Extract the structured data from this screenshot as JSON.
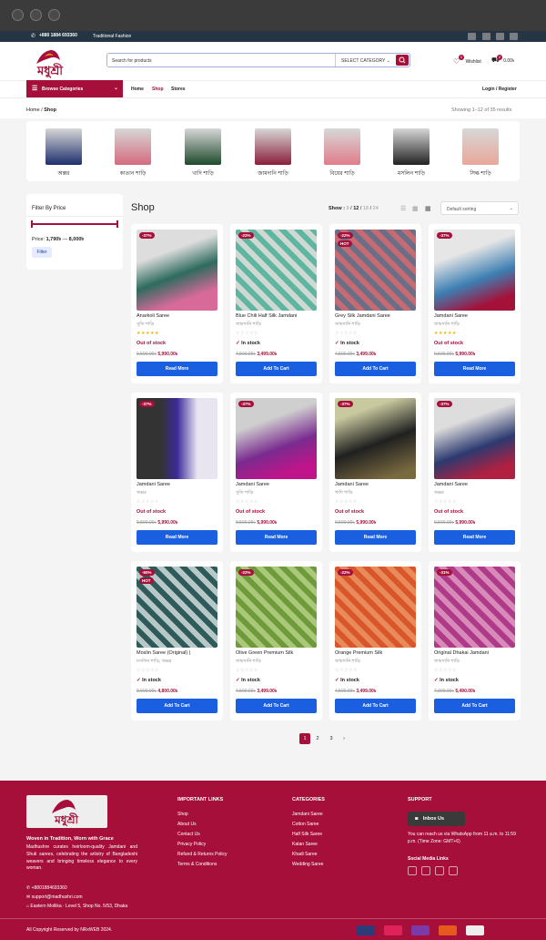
{
  "topbar": {
    "phone": "+880 1884 693360",
    "tagline": "Traditional Fashion"
  },
  "header": {
    "logo_text": "মধুশ্রী",
    "search_placeholder": "Search for products",
    "category_select": "SELECT CATEGORY",
    "wishlist": "Wishlist",
    "wishlist_count": "0",
    "cart_total": "0.00৳",
    "cart_count": "0"
  },
  "nav": {
    "browse": "Browse Categories",
    "links": [
      "Home",
      "Shop",
      "Stores"
    ],
    "login": "Login / Register"
  },
  "breadcrumb": {
    "home": "Home",
    "current": "Shop",
    "results": "Showing 1–12 of 35 results"
  },
  "categories": [
    "অক্সর",
    "কাতান শাড়ি",
    "খাদি শাড়ি",
    "জামদানি শাড়ি",
    "বিয়ের শাড়ি",
    "মসলিন শাড়ি",
    "সিল্ক শাড়ি"
  ],
  "filter": {
    "title": "Filter By Price",
    "price_label": "Price:",
    "min": "1,790৳",
    "max": "8,000৳",
    "button": "Filter"
  },
  "shop": {
    "title": "Shop",
    "show_label": "Show :",
    "show_options": [
      "9",
      "12",
      "18",
      "24"
    ],
    "sort": "Default sorting"
  },
  "products": [
    {
      "name": "Anarkoli Saree",
      "bn": "সুতি শাড়ি",
      "badge": "-37%",
      "hot": "",
      "stars": "★★★★★",
      "stock": "Out of stock",
      "old": "9,500.00৳",
      "price": "5,990.00৳",
      "cta": "Read More"
    },
    {
      "name": "Blue Chili Half Silk Jamdani",
      "bn": "জামদানি শাড়ি",
      "badge": "-22%",
      "hot": "",
      "stars": "☆☆☆☆☆",
      "stock": "In stock",
      "old": "4,500.00৳",
      "price": "3,499.00৳",
      "cta": "Add To Cart"
    },
    {
      "name": "Grey Silk Jamdani Saree",
      "bn": "জামদানি শাড়ি",
      "badge": "-22%",
      "hot": "HOT",
      "stars": "☆☆☆☆☆",
      "stock": "In stock",
      "old": "4,500.00৳",
      "price": "3,499.00৳",
      "cta": "Add To Cart"
    },
    {
      "name": "Jamdani Saree",
      "bn": "জামদানি শাড়ি",
      "badge": "-37%",
      "hot": "",
      "stars": "★★★★★",
      "stock": "Out of stock",
      "old": "9,500.00৳",
      "price": "5,990.00৳",
      "cta": "Read More"
    },
    {
      "name": "Jamdani Saree",
      "bn": "অক্সর",
      "badge": "-37%",
      "hot": "",
      "stars": "☆☆☆☆☆",
      "stock": "Out of stock",
      "old": "9,500.00৳",
      "price": "5,990.00৳",
      "cta": "Read More"
    },
    {
      "name": "Jamdani Saree",
      "bn": "সুতি শাড়ি",
      "badge": "-37%",
      "hot": "",
      "stars": "☆☆☆☆☆",
      "stock": "Out of stock",
      "old": "9,500.00৳",
      "price": "5,990.00৳",
      "cta": "Read More"
    },
    {
      "name": "Jamdani Saree",
      "bn": "খাদি শাড়ি",
      "badge": "-37%",
      "hot": "",
      "stars": "☆☆☆☆☆",
      "stock": "Out of stock",
      "old": "9,500.00৳",
      "price": "5,990.00৳",
      "cta": "Read More"
    },
    {
      "name": "Jamdani Saree",
      "bn": "অক্সর",
      "badge": "-37%",
      "hot": "",
      "stars": "☆☆☆☆☆",
      "stock": "Out of stock",
      "old": "9,500.00৳",
      "price": "5,990.00৳",
      "cta": "Read More"
    },
    {
      "name": "Moslin Saree (Original) |",
      "bn": "মসলিন শাড়ি, অক্সর",
      "badge": "-50%",
      "hot": "HOT",
      "stars": "☆☆☆☆☆",
      "stock": "In stock",
      "old": "9,600.00৳",
      "price": "4,800.00৳",
      "cta": "Add To Cart"
    },
    {
      "name": "Olive Green Premium Silk",
      "bn": "জামদানি শাড়ি",
      "badge": "-22%",
      "hot": "",
      "stars": "☆☆☆☆☆",
      "stock": "In stock",
      "old": "4,500.00৳",
      "price": "3,499.00৳",
      "cta": "Add To Cart"
    },
    {
      "name": "Orange Premium Silk",
      "bn": "জামদানি শাড়ি",
      "badge": "-22%",
      "hot": "",
      "stars": "☆☆☆☆☆",
      "stock": "In stock",
      "old": "4,500.00৳",
      "price": "3,499.00৳",
      "cta": "Add To Cart"
    },
    {
      "name": "Original Dhakai Jamdani",
      "bn": "জামদানি শাড়ি",
      "badge": "-31%",
      "hot": "",
      "stars": "☆☆☆☆☆",
      "stock": "In stock",
      "old": "7,900.00৳",
      "price": "5,490.00৳",
      "cta": "Add To Cart"
    }
  ],
  "pagination": [
    "1",
    "2",
    "3",
    "›"
  ],
  "footer": {
    "tagline": "Woven in Tradition, Worn with Grace",
    "desc": "Madhushre curates heirloom-quality Jamdani and Shuti sarees, celebrating the artistry of Bangladeshi weavers and bringing timeless elegance to every woman.",
    "phone": "+8801884693360",
    "email": "support@madhushri.com",
    "address": "Eastern Mollika · Level 5, Shop No. 5/53, Dhaka",
    "links_title": "IMPORTANT LINKS",
    "links": [
      "Shop",
      "About Us",
      "Contact Us",
      "Privacy Policy",
      "Refund & Returns Policy",
      "Terms & Conditions"
    ],
    "cats_title": "CATEGORIES",
    "cats": [
      "Jamdani Saree",
      "Cotton Saree",
      "Half Silk Saree",
      "Katan Saree",
      "Khadi Saree",
      "Wedding Saree"
    ],
    "support_title": "SUPPORT",
    "inbox": "Inbox Us",
    "support_text": "You can reach us via WhatsApp from 11 a.m. to 11:59 p.m. (Time Zone: GMT+6)",
    "social_title": "Social Media Links",
    "copyright": "All Copyright Reserved by NRxWEB 2024."
  },
  "colors": {
    "brand": "#a50f3a",
    "button": "#1a5fe0",
    "topbar": "#263544"
  }
}
